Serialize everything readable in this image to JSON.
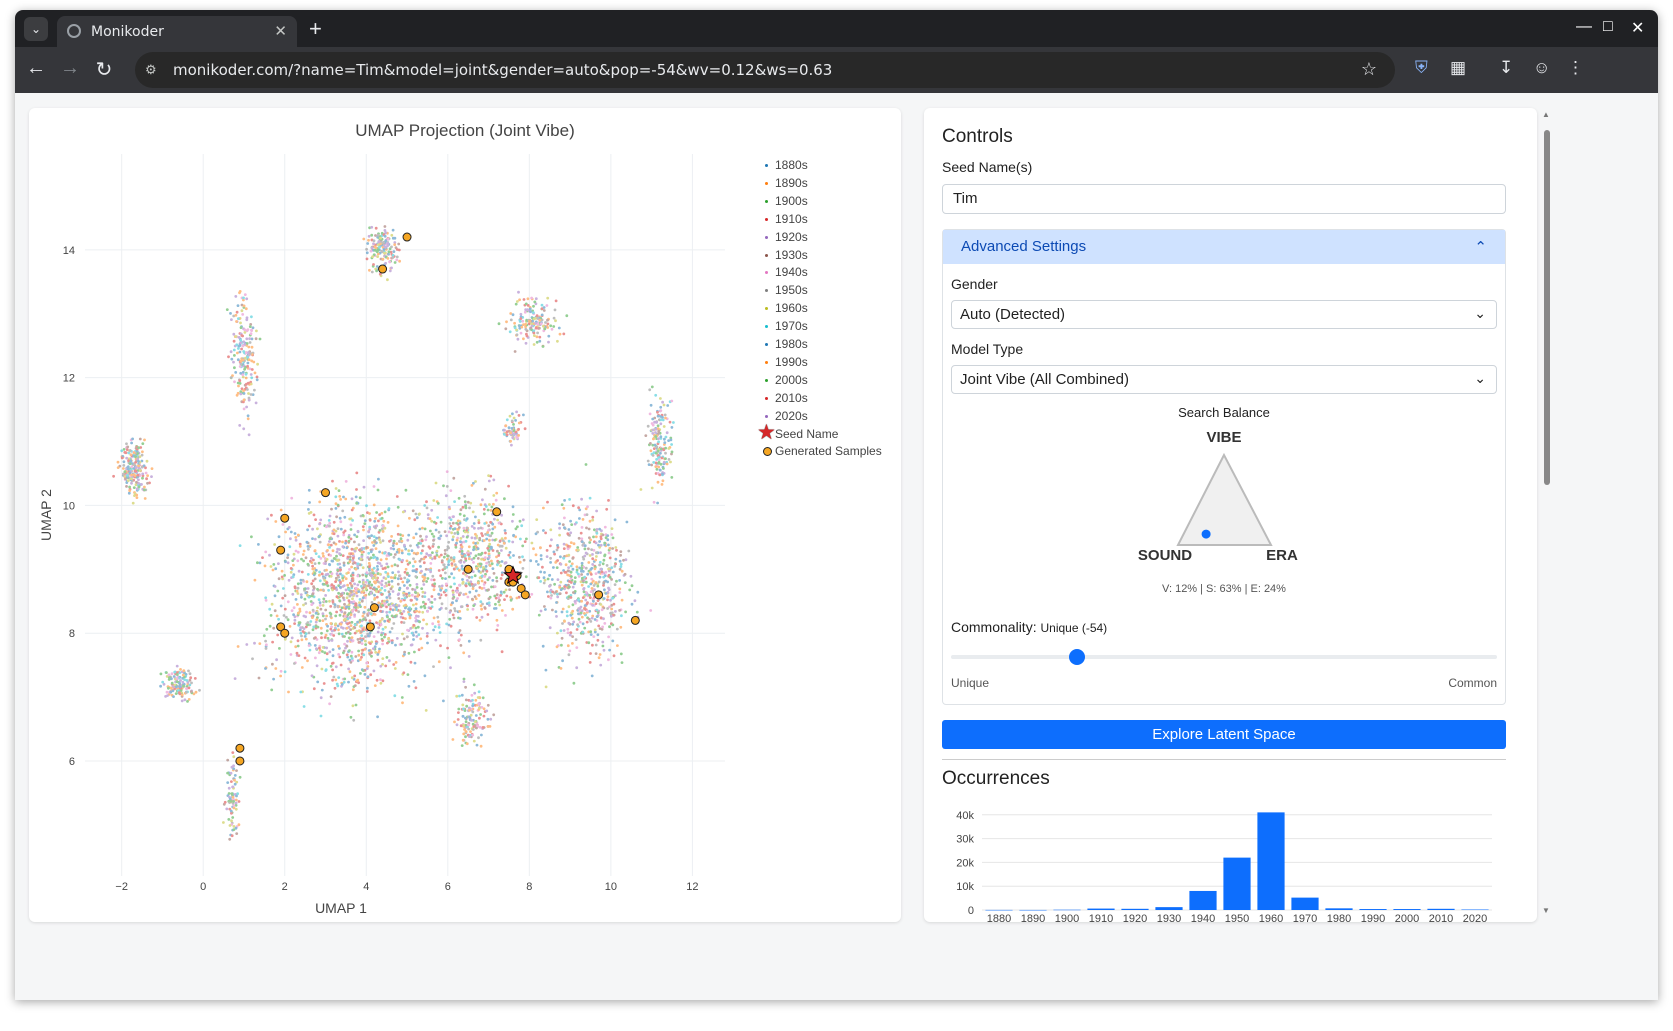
{
  "browser": {
    "tab_title": "Monikoder",
    "url": "monikoder.com/?name=Tim&model=joint&gender=auto&pop=-54&wv=0.12&ws=0.63"
  },
  "chart_data": [
    {
      "type": "scatter",
      "title": "UMAP Projection (Joint Vibe)",
      "xlabel": "UMAP 1",
      "ylabel": "UMAP 2",
      "xlim": [
        -2.9,
        12.8
      ],
      "ylim": [
        4.2,
        15.5
      ],
      "x_ticks": [
        -2,
        0,
        2,
        4,
        6,
        8,
        10,
        12
      ],
      "y_ticks": [
        6,
        8,
        10,
        12,
        14
      ],
      "grid": true,
      "legend_placement": "right",
      "series": [
        {
          "name": "1880s",
          "color": "#1f77b4"
        },
        {
          "name": "1890s",
          "color": "#ff7f0e"
        },
        {
          "name": "1900s",
          "color": "#2ca02c"
        },
        {
          "name": "1910s",
          "color": "#d62728"
        },
        {
          "name": "1920s",
          "color": "#9467bd"
        },
        {
          "name": "1930s",
          "color": "#8c564b"
        },
        {
          "name": "1940s",
          "color": "#e377c2"
        },
        {
          "name": "1950s",
          "color": "#7f7f7f"
        },
        {
          "name": "1960s",
          "color": "#bcbd22"
        },
        {
          "name": "1970s",
          "color": "#17becf"
        },
        {
          "name": "1980s",
          "color": "#1f77b4"
        },
        {
          "name": "1990s",
          "color": "#ff7f0e"
        },
        {
          "name": "2000s",
          "color": "#2ca02c"
        },
        {
          "name": "2010s",
          "color": "#d62728"
        },
        {
          "name": "2020s",
          "color": "#9467bd"
        },
        {
          "name": "Seed Name",
          "color": "#d62728",
          "marker": "star",
          "points": [
            [
              7.6,
              8.9
            ]
          ]
        },
        {
          "name": "Generated Samples",
          "color": "#f5a623",
          "marker": "circle",
          "points": [
            [
              5.0,
              14.2
            ],
            [
              4.4,
              13.7
            ],
            [
              3.0,
              10.2
            ],
            [
              2.0,
              9.8
            ],
            [
              1.9,
              9.3
            ],
            [
              7.2,
              9.9
            ],
            [
              6.5,
              9.0
            ],
            [
              7.5,
              9.0
            ],
            [
              7.7,
              8.9
            ],
            [
              7.5,
              8.8
            ],
            [
              7.6,
              8.8
            ],
            [
              7.8,
              8.7
            ],
            [
              7.9,
              8.6
            ],
            [
              9.7,
              8.6
            ],
            [
              10.6,
              8.2
            ],
            [
              4.2,
              8.4
            ],
            [
              4.1,
              8.1
            ],
            [
              1.9,
              8.1
            ],
            [
              2.0,
              8.0
            ],
            [
              0.9,
              6.2
            ],
            [
              0.9,
              6.0
            ]
          ]
        }
      ]
    },
    {
      "type": "bar",
      "title": "",
      "categories": [
        "1880",
        "1890",
        "1900",
        "1910",
        "1920",
        "1930",
        "1940",
        "1950",
        "1960",
        "1970",
        "1980",
        "1990",
        "2000",
        "2010",
        "2020"
      ],
      "values": [
        40,
        30,
        120,
        600,
        500,
        1200,
        8000,
        22000,
        41000,
        5200,
        700,
        400,
        400,
        500,
        200
      ],
      "color": "#0d6efd",
      "ylim": [
        0,
        42000
      ],
      "y_ticks": [
        "0",
        "10k",
        "20k",
        "30k",
        "40k"
      ],
      "grid": true
    }
  ],
  "controls": {
    "heading": "Controls",
    "seed_label": "Seed Name(s)",
    "seed_value": "Tim",
    "advanced_label": "Advanced Settings",
    "gender_label": "Gender",
    "gender_value": "Auto (Detected)",
    "model_label": "Model Type",
    "model_value": "Joint Vibe (All Combined)",
    "balance_title": "Search Balance",
    "vibe_label": "VIBE",
    "sound_label": "SOUND",
    "era_label": "ERA",
    "balance_readout": "V: 12% | S: 63% | E: 24%",
    "balance_weights": {
      "vibe": 0.12,
      "sound": 0.63,
      "era": 0.24
    },
    "commonality_label": "Commonality:",
    "commonality_value": "Unique (-54)",
    "commonality_level": 0.23,
    "slider_min_label": "Unique",
    "slider_max_label": "Common",
    "explore_button": "Explore Latent Space",
    "occurrences_heading": "Occurrences"
  },
  "colors": {
    "accent": "#0d6efd",
    "accordion_bg": "#cfe2ff",
    "sample_marker": "#f5a623"
  }
}
